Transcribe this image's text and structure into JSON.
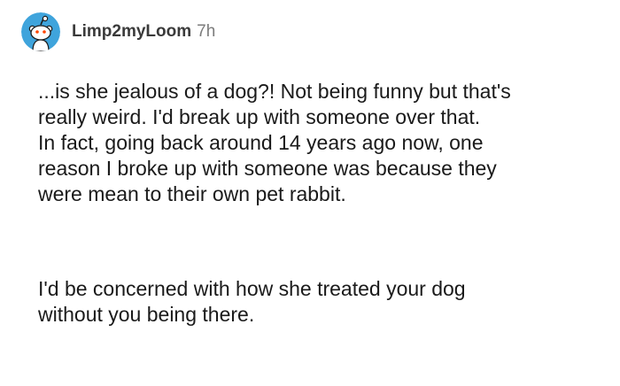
{
  "comment": {
    "avatar_icon": "reddit-snoo-avatar",
    "avatar_color": "#3fa4dc",
    "username": "Limp2myLoom",
    "age": "7h",
    "paragraph_1_lines": [
      "...is she jealous of a dog?! Not being funny but that's",
      "really weird. I'd break up with someone over that.",
      "In fact, going back around 14 years ago now, one",
      "reason I broke up with someone was because they",
      "were mean to their own pet rabbit."
    ],
    "paragraph_2_lines": [
      "I'd be concerned with how she treated your dog",
      "without you being there."
    ]
  }
}
